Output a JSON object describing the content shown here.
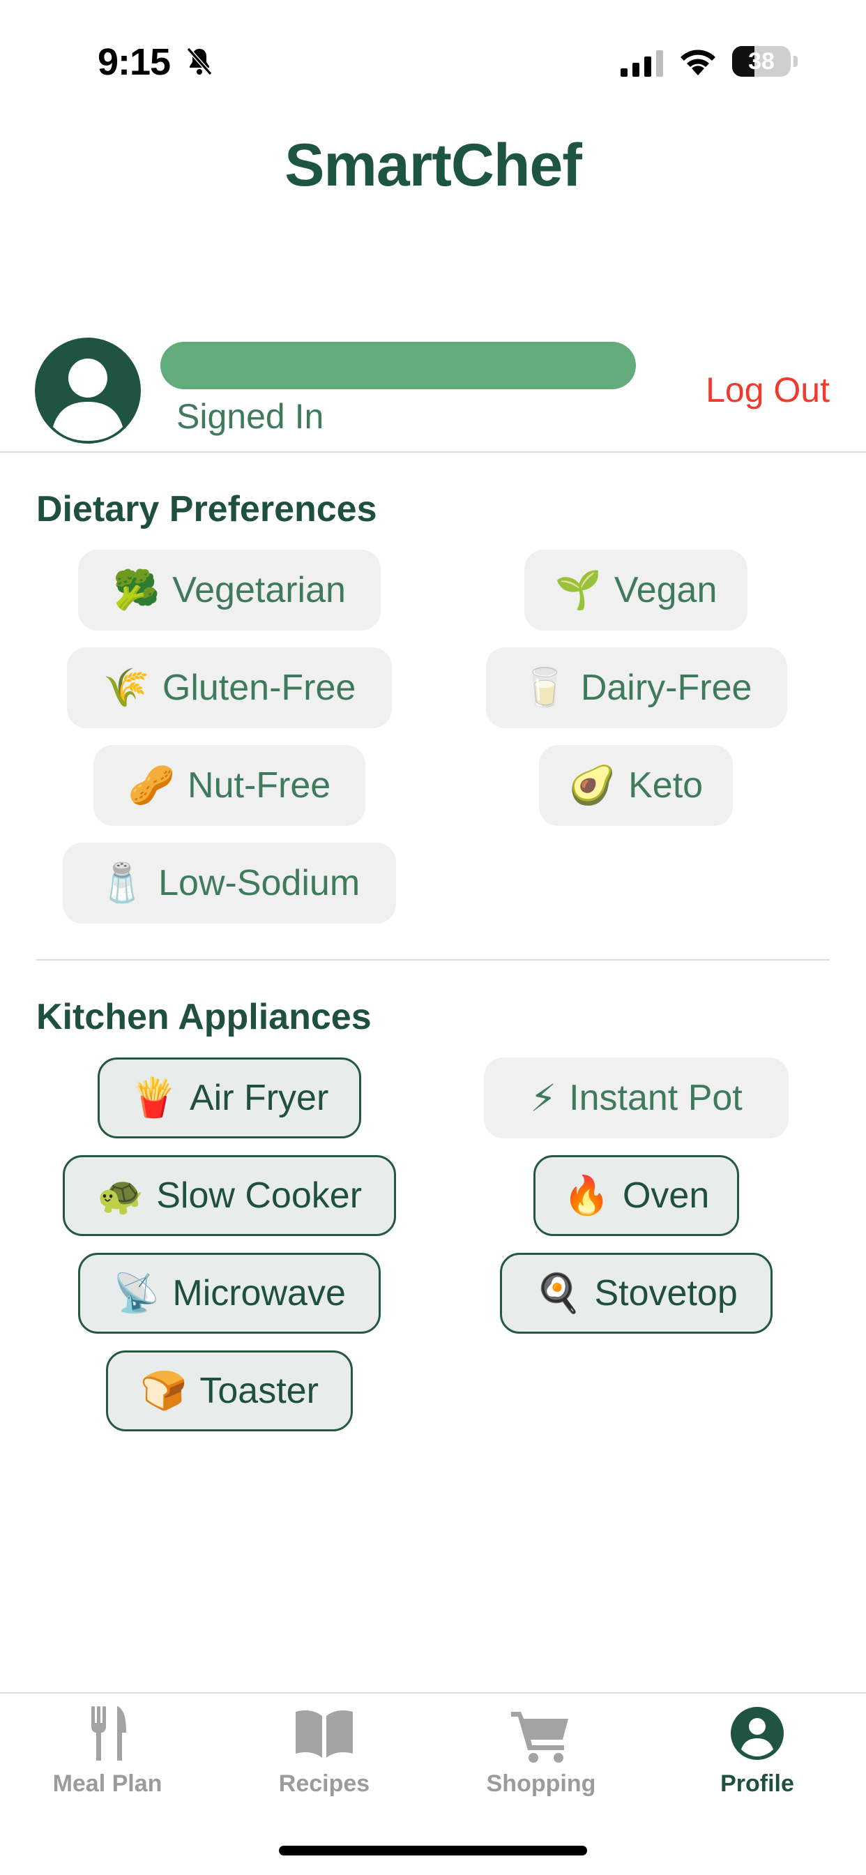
{
  "status_bar": {
    "time": "9:15",
    "battery": "38",
    "battery_level": 0.38
  },
  "app": {
    "title": "SmartChef"
  },
  "profile": {
    "status": "Signed In",
    "logout_label": "Log Out"
  },
  "dietary": {
    "heading": "Dietary Preferences",
    "items": [
      {
        "emoji": "🥦",
        "label": "Vegetarian",
        "selected": false
      },
      {
        "emoji": "🌱",
        "label": "Vegan",
        "selected": false
      },
      {
        "emoji": "🌾",
        "label": "Gluten-Free",
        "selected": false
      },
      {
        "emoji": "🥛",
        "label": "Dairy-Free",
        "selected": false
      },
      {
        "emoji": "🥜",
        "label": "Nut-Free",
        "selected": false
      },
      {
        "emoji": "🥑",
        "label": "Keto",
        "selected": false
      },
      {
        "emoji": "🧂",
        "label": "Low-Sodium",
        "selected": false
      }
    ]
  },
  "appliances": {
    "heading": "Kitchen Appliances",
    "items": [
      {
        "emoji": "🍟",
        "label": "Air Fryer",
        "selected": true
      },
      {
        "emoji": "⚡",
        "label": "Instant Pot",
        "selected": false
      },
      {
        "emoji": "🐢",
        "label": "Slow Cooker",
        "selected": true
      },
      {
        "emoji": "🔥",
        "label": "Oven",
        "selected": true
      },
      {
        "emoji": "📡",
        "label": "Microwave",
        "selected": true
      },
      {
        "emoji": "🍳",
        "label": "Stovetop",
        "selected": true
      },
      {
        "emoji": "🍞",
        "label": "Toaster",
        "selected": true
      }
    ]
  },
  "tabs": [
    {
      "label": "Meal Plan",
      "icon": "fork-knife-icon",
      "active": false
    },
    {
      "label": "Recipes",
      "icon": "book-icon",
      "active": false
    },
    {
      "label": "Shopping",
      "icon": "cart-icon",
      "active": false
    },
    {
      "label": "Profile",
      "icon": "profile-icon",
      "active": true
    }
  ],
  "colors": {
    "brand": "#1d5442",
    "accent": "#62ac7b",
    "logout": "#ef3b2f",
    "inactive": "#9b9b9b"
  }
}
